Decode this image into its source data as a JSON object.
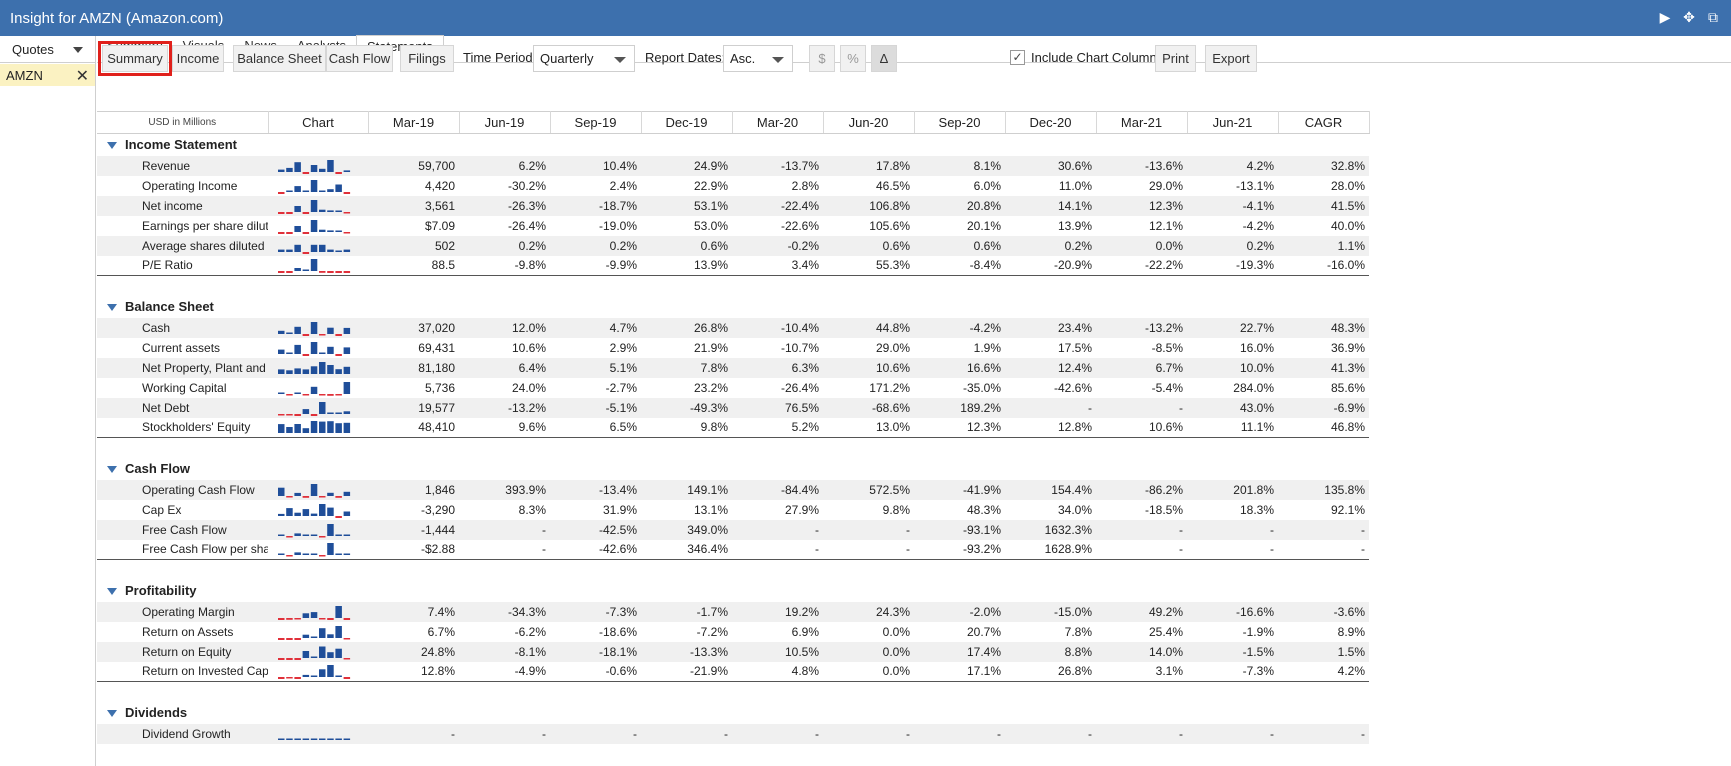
{
  "window": {
    "title": "Insight for AMZN (Amazon.com)"
  },
  "sidebar": {
    "quotes_label": "Quotes",
    "symbol": "AMZN"
  },
  "tabs": [
    "Summary",
    "Visuals",
    "News",
    "Analysts",
    "Statements"
  ],
  "active_tab": "Statements",
  "toolbar": {
    "buttons": [
      "Summary",
      "Income",
      "Balance Sheet",
      "Cash Flow",
      "Filings"
    ],
    "time_period_label": "Time Period:",
    "time_period_value": "Quarterly",
    "report_dates_label": "Report Dates:",
    "report_dates_value": "Asc.",
    "dollar_label": "$",
    "percent_label": "%",
    "delta_label": "Δ",
    "include_chart_label": "Include Chart Column",
    "print_label": "Print",
    "export_label": "Export"
  },
  "table": {
    "unit_label": "USD in Millions",
    "chart_header": "Chart",
    "columns": [
      "Mar-19",
      "Jun-19",
      "Sep-19",
      "Dec-19",
      "Mar-20",
      "Jun-20",
      "Sep-20",
      "Dec-20",
      "Mar-21",
      "Jun-21",
      "CAGR"
    ],
    "sections": [
      {
        "title": "Income Statement",
        "rows": [
          {
            "label": "Revenue",
            "values": [
              "59,700",
              "6.2%",
              "10.4%",
              "24.9%",
              "-13.7%",
              "17.8%",
              "8.1%",
              "30.6%",
              "-13.6%",
              "4.2%",
              "32.8%"
            ]
          },
          {
            "label": "Operating Income",
            "values": [
              "4,420",
              "-30.2%",
              "2.4%",
              "22.9%",
              "2.8%",
              "46.5%",
              "6.0%",
              "11.0%",
              "29.0%",
              "-13.1%",
              "28.0%"
            ]
          },
          {
            "label": "Net income",
            "values": [
              "3,561",
              "-26.3%",
              "-18.7%",
              "53.1%",
              "-22.4%",
              "106.8%",
              "20.8%",
              "14.1%",
              "12.3%",
              "-4.1%",
              "41.5%"
            ]
          },
          {
            "label": "Earnings per share diluted",
            "values": [
              "$7.09",
              "-26.4%",
              "-19.0%",
              "53.0%",
              "-22.6%",
              "105.6%",
              "20.1%",
              "13.9%",
              "12.1%",
              "-4.2%",
              "40.0%"
            ]
          },
          {
            "label": "Average shares diluted",
            "values": [
              "502",
              "0.2%",
              "0.2%",
              "0.6%",
              "-0.2%",
              "0.6%",
              "0.6%",
              "0.2%",
              "0.0%",
              "0.2%",
              "1.1%"
            ]
          },
          {
            "label": "P/E Ratio",
            "values": [
              "88.5",
              "-9.8%",
              "-9.9%",
              "13.9%",
              "3.4%",
              "55.3%",
              "-8.4%",
              "-20.9%",
              "-22.2%",
              "-19.3%",
              "-16.0%"
            ]
          }
        ]
      },
      {
        "title": "Balance Sheet",
        "rows": [
          {
            "label": "Cash",
            "values": [
              "37,020",
              "12.0%",
              "4.7%",
              "26.8%",
              "-10.4%",
              "44.8%",
              "-4.2%",
              "23.4%",
              "-13.2%",
              "22.7%",
              "48.3%"
            ]
          },
          {
            "label": "Current assets",
            "values": [
              "69,431",
              "10.6%",
              "2.9%",
              "21.9%",
              "-10.7%",
              "29.0%",
              "1.9%",
              "17.5%",
              "-8.5%",
              "16.0%",
              "36.9%"
            ]
          },
          {
            "label": "Net Property, Plant and ...",
            "values": [
              "81,180",
              "6.4%",
              "5.1%",
              "7.8%",
              "6.3%",
              "10.6%",
              "16.6%",
              "12.4%",
              "6.7%",
              "10.0%",
              "41.3%"
            ]
          },
          {
            "label": "Working Capital",
            "values": [
              "5,736",
              "24.0%",
              "-2.7%",
              "23.2%",
              "-26.4%",
              "171.2%",
              "-35.0%",
              "-42.6%",
              "-5.4%",
              "284.0%",
              "85.6%"
            ]
          },
          {
            "label": "Net Debt",
            "values": [
              "19,577",
              "-13.2%",
              "-5.1%",
              "-49.3%",
              "76.5%",
              "-68.6%",
              "189.2%",
              "-",
              "-",
              "43.0%",
              "-6.9%"
            ]
          },
          {
            "label": "Stockholders' Equity",
            "values": [
              "48,410",
              "9.6%",
              "6.5%",
              "9.8%",
              "5.2%",
              "13.0%",
              "12.3%",
              "12.8%",
              "10.6%",
              "11.1%",
              "46.8%"
            ]
          }
        ]
      },
      {
        "title": "Cash Flow",
        "rows": [
          {
            "label": "Operating Cash Flow",
            "values": [
              "1,846",
              "393.9%",
              "-13.4%",
              "149.1%",
              "-84.4%",
              "572.5%",
              "-41.9%",
              "154.4%",
              "-86.2%",
              "201.8%",
              "135.8%"
            ]
          },
          {
            "label": "Cap Ex",
            "values": [
              "-3,290",
              "8.3%",
              "31.9%",
              "13.1%",
              "27.9%",
              "9.8%",
              "48.3%",
              "34.0%",
              "-18.5%",
              "18.3%",
              "92.1%"
            ]
          },
          {
            "label": "Free Cash Flow",
            "values": [
              "-1,444",
              "-",
              "-42.5%",
              "349.0%",
              "-",
              "-",
              "-93.1%",
              "1632.3%",
              "-",
              "-",
              "-"
            ]
          },
          {
            "label": "Free Cash Flow per share",
            "values": [
              "-$2.88",
              "-",
              "-42.6%",
              "346.4%",
              "-",
              "-",
              "-93.2%",
              "1628.9%",
              "-",
              "-",
              "-"
            ]
          }
        ]
      },
      {
        "title": "Profitability",
        "rows": [
          {
            "label": "Operating Margin",
            "values": [
              "7.4%",
              "-34.3%",
              "-7.3%",
              "-1.7%",
              "19.2%",
              "24.3%",
              "-2.0%",
              "-15.0%",
              "49.2%",
              "-16.6%",
              "-3.6%"
            ]
          },
          {
            "label": "Return on Assets",
            "values": [
              "6.7%",
              "-6.2%",
              "-18.6%",
              "-7.2%",
              "6.9%",
              "0.0%",
              "20.7%",
              "7.8%",
              "25.4%",
              "-1.9%",
              "8.9%"
            ]
          },
          {
            "label": "Return on Equity",
            "values": [
              "24.8%",
              "-8.1%",
              "-18.1%",
              "-13.3%",
              "10.5%",
              "0.0%",
              "17.4%",
              "8.8%",
              "14.0%",
              "-1.5%",
              "1.5%"
            ]
          },
          {
            "label": "Return on Invested Capital",
            "values": [
              "12.8%",
              "-4.9%",
              "-0.6%",
              "-21.9%",
              "4.8%",
              "0.0%",
              "17.1%",
              "26.8%",
              "3.1%",
              "-7.3%",
              "4.2%"
            ]
          }
        ]
      },
      {
        "title": "Dividends",
        "rows": [
          {
            "label": "Dividend Growth",
            "values": [
              "-",
              "-",
              "-",
              "-",
              "-",
              "-",
              "-",
              "-",
              "-",
              "-",
              "-"
            ]
          }
        ]
      }
    ]
  },
  "colors": {
    "titlebar": "#3d70ad",
    "positive_bar": "#1f4e99",
    "negative_bar": "#e0303a",
    "highlight": "#e0201b",
    "row_stripe": "#f0f0f0"
  }
}
